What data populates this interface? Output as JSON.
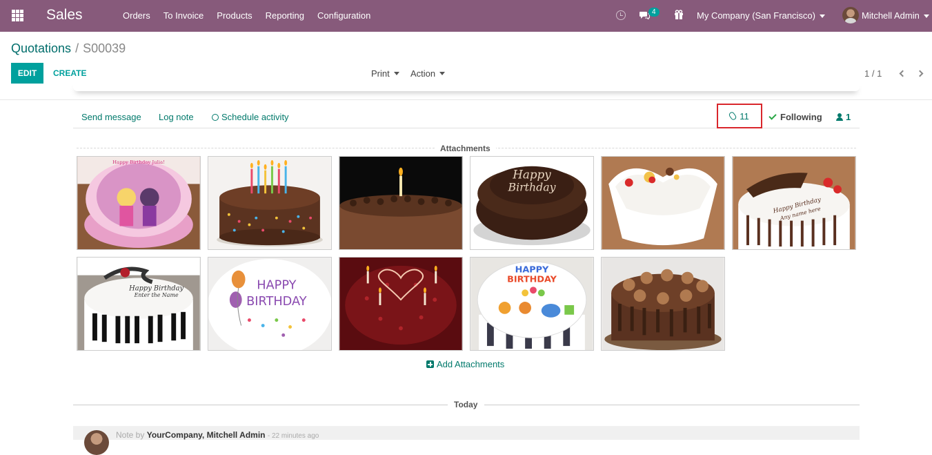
{
  "navbar": {
    "brand": "Sales",
    "menu": [
      "Orders",
      "To Invoice",
      "Products",
      "Reporting",
      "Configuration"
    ],
    "messages_badge": "4",
    "company": "My Company (San Francisco)",
    "user": "Mitchell Admin"
  },
  "control_panel": {
    "breadcrumb_parent": "Quotations",
    "breadcrumb_sep": "/",
    "breadcrumb_current": "S00039",
    "edit": "EDIT",
    "create": "CREATE",
    "print": "Print",
    "action": "Action",
    "pager": "1 / 1"
  },
  "chatter": {
    "send_message": "Send message",
    "log_note": "Log note",
    "schedule_activity": "Schedule activity",
    "attachments_count": "11",
    "following": "Following",
    "followers_count": "1",
    "attachments_title": "Attachments",
    "add_attachments": "Add Attachments",
    "today": "Today",
    "message": {
      "prefix": "Note by",
      "author": "YourCompany, Mitchell Admin",
      "time": "- 22 minutes ago"
    }
  },
  "attachments": [
    {
      "name": "cake-1",
      "caption": "Happy Birthday Julia!",
      "theme": "pink"
    },
    {
      "name": "cake-2",
      "caption": "",
      "theme": "chocolate-candles"
    },
    {
      "name": "cake-3",
      "caption": "",
      "theme": "chocolate-dark"
    },
    {
      "name": "cake-4",
      "caption": "Happy Birthday",
      "theme": "chocolate-script"
    },
    {
      "name": "cake-5",
      "caption": "",
      "theme": "white-heart"
    },
    {
      "name": "cake-6",
      "caption": "Happy Birthday Any name here",
      "theme": "white-drip"
    },
    {
      "name": "cake-7",
      "caption": "Happy Birthday Enter the Name",
      "theme": "piano"
    },
    {
      "name": "cake-8",
      "caption": "HAPPY BIRTHDAY",
      "theme": "balloons"
    },
    {
      "name": "cake-9",
      "caption": "",
      "theme": "red-heart"
    },
    {
      "name": "cake-10",
      "caption": "HAPPY BIRTHDAY",
      "theme": "cartoon"
    },
    {
      "name": "cake-11",
      "caption": "",
      "theme": "chocolate-drip"
    }
  ],
  "colors": {
    "navbar": "#875a7b",
    "primary": "#00a09d",
    "link": "#00796b",
    "highlight_border": "#d9262b"
  }
}
